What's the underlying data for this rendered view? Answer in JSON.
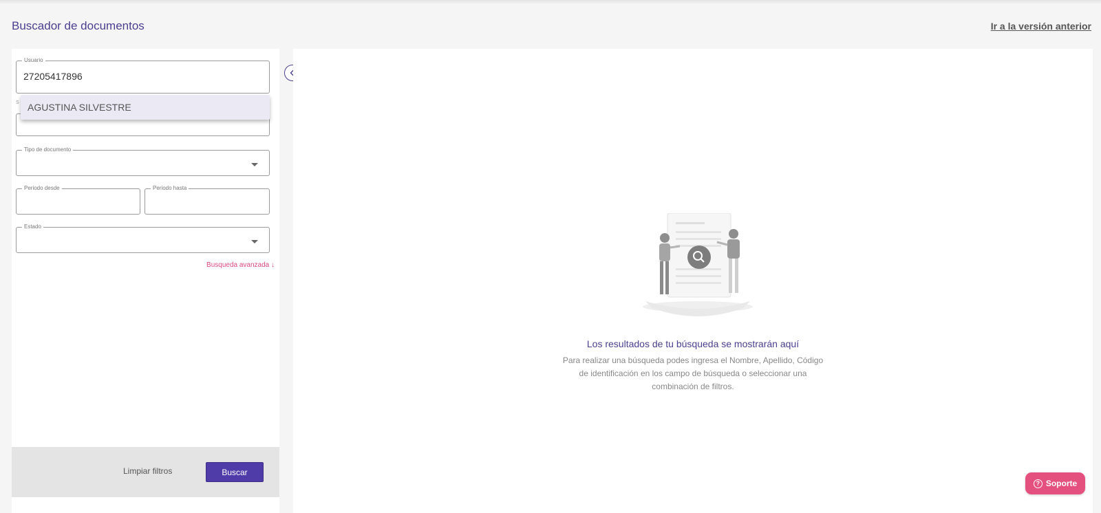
{
  "header": {
    "title": "Buscador de documentos",
    "old_version_link": "Ir a la versión anterior"
  },
  "filters": {
    "user": {
      "label": "Usuario",
      "value": "27205417896"
    },
    "second_field_label": "S",
    "document_type": {
      "label": "Tipo de documento",
      "value": ""
    },
    "period_from": {
      "label": "Periodo desde",
      "value": ""
    },
    "period_to": {
      "label": "Periodo hasta",
      "value": ""
    },
    "status": {
      "label": "Estado",
      "value": ""
    },
    "advanced_search": "Busqueda avanzada ↓",
    "suggestion": "AGUSTINA SILVESTRE"
  },
  "actions": {
    "clear": "Limpiar filtros",
    "search": "Buscar"
  },
  "results": {
    "empty_title": "Los resultados de tu búsqueda se mostrarán aquí",
    "empty_description": "Para realizar una búsqueda podes ingresa el Nombre, Apellido, Código de identificación en los campo de búsqueda o seleccionar una combinación de filtros."
  },
  "support": {
    "label": "Soporte",
    "icon": "help-circle-icon"
  },
  "colors": {
    "primary": "#4f3ca8",
    "title": "#4a3f8f",
    "accent": "#e5517f",
    "link_accent": "#d9487e"
  }
}
